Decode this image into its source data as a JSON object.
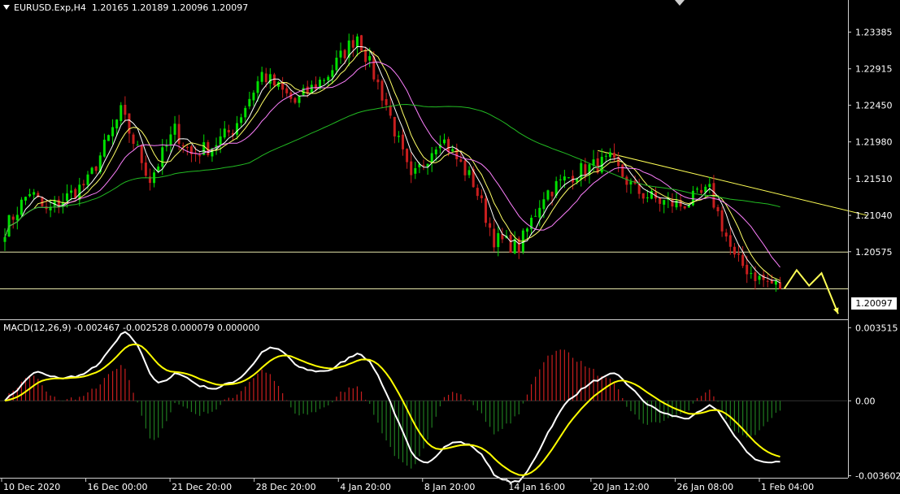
{
  "header": {
    "symbol": "EURUSD.Exp,H4",
    "ohlc": "1.20165 1.20189 1.20096 1.20097"
  },
  "macd_header": "MACD(12,26,9) -0.002467 -0.002528 0.000079 0.000000",
  "current_price": "1.20097",
  "colors": {
    "background": "#000000",
    "bull_candle": "#00e000",
    "bear_candle": "#c81e1e",
    "ma_fast": "#ffffff",
    "ma_mid": "#ffff66",
    "ma_slow": "#ff80ff",
    "ma_long": "#22bb22",
    "trendline": "#ffff55",
    "macd_line": "#ffffff",
    "signal_line": "#ffff00",
    "hist_pos": "#c81e1e",
    "hist_neg": "#1f7a1f",
    "axis_text": "#ffffff",
    "hline": "#e6e6aa"
  },
  "chart_data": [
    {
      "type": "line",
      "title": "EURUSD.Exp,H4",
      "x_tick_labels": [
        "10 Dec 2020",
        "16 Dec 00:00",
        "21 Dec 20:00",
        "28 Dec 20:00",
        "4 Jan 20:00",
        "8 Jan 20:00",
        "14 Jan 16:00",
        "20 Jan 12:00",
        "26 Jan 08:00",
        "1 Feb 04:00"
      ],
      "y_tick_labels": [
        "1.23385",
        "1.22915",
        "1.22450",
        "1.21980",
        "1.21510",
        "1.21040",
        "1.20575"
      ],
      "ylim": [
        1.1972,
        1.2364
      ],
      "x_count": 188,
      "horizontal_levels": [
        1.2057,
        1.201
      ],
      "trendline": {
        "start": [
          143,
          1.2187
        ],
        "end": [
          208,
          1.2104
        ]
      },
      "projection_path": [
        [
          188,
          1.201
        ],
        [
          191,
          1.2034
        ],
        [
          194,
          1.2014
        ],
        [
          197,
          1.203
        ],
        [
          201,
          1.1978
        ]
      ],
      "price_anchors": [
        [
          0,
          1.2087
        ],
        [
          6,
          1.2135
        ],
        [
          10,
          1.2108
        ],
        [
          20,
          1.2147
        ],
        [
          28,
          1.2236
        ],
        [
          35,
          1.215
        ],
        [
          41,
          1.2213
        ],
        [
          45,
          1.2182
        ],
        [
          50,
          1.2193
        ],
        [
          55,
          1.2214
        ],
        [
          62,
          1.2285
        ],
        [
          70,
          1.2248
        ],
        [
          78,
          1.2285
        ],
        [
          85,
          1.2335
        ],
        [
          92,
          1.2246
        ],
        [
          98,
          1.2147
        ],
        [
          105,
          1.2206
        ],
        [
          113,
          1.2146
        ],
        [
          118,
          1.2074
        ],
        [
          124,
          1.2063
        ],
        [
          130,
          1.2131
        ],
        [
          138,
          1.216
        ],
        [
          146,
          1.2174
        ],
        [
          152,
          1.2136
        ],
        [
          158,
          1.2122
        ],
        [
          163,
          1.2117
        ],
        [
          170,
          1.2135
        ],
        [
          176,
          1.2048
        ],
        [
          182,
          1.2023
        ],
        [
          188,
          1.201
        ]
      ],
      "moving_averages": [
        {
          "name": "ma_fast",
          "period": 5
        },
        {
          "name": "ma_mid",
          "period": 8
        },
        {
          "name": "ma_slow",
          "period": 15
        },
        {
          "name": "ma_long",
          "period": 60
        }
      ]
    },
    {
      "type": "line",
      "title": "MACD(12,26,9)",
      "y_tick_labels": [
        "0.003515",
        "0.00",
        "-0.003602"
      ],
      "ylim": [
        -0.0037,
        0.0038
      ],
      "series": [
        {
          "name": "MACD",
          "key": "macd"
        },
        {
          "name": "Signal",
          "key": "signal"
        },
        {
          "name": "Histogram",
          "key": "hist"
        }
      ]
    }
  ]
}
